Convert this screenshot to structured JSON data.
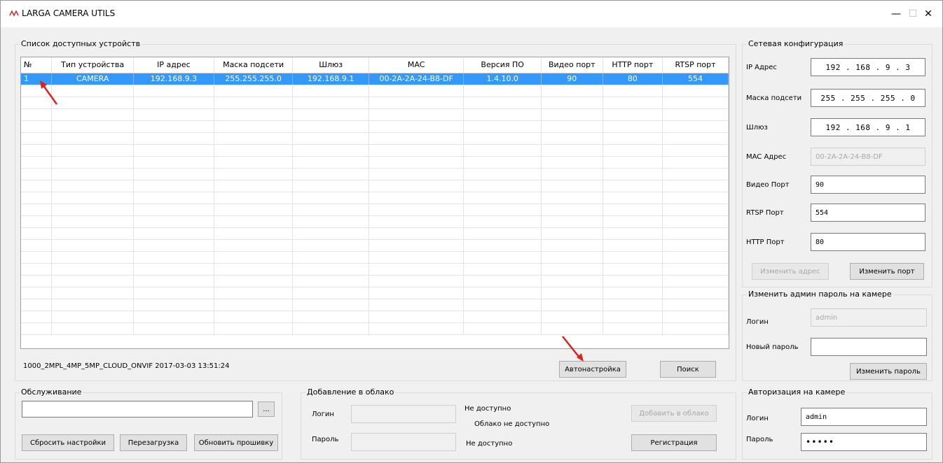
{
  "window": {
    "title": "LARGA CAMERA UTILS",
    "minimize": "—",
    "maximize": "☐",
    "close": "✕"
  },
  "devices": {
    "group_label": "Список доступных устройств",
    "columns": [
      "№",
      "Тип устройства",
      "IP адрес",
      "Маска подсети",
      "Шлюз",
      "MAC",
      "Версия ПО",
      "Видео порт",
      "HTTP порт",
      "RTSP порт"
    ],
    "rows": [
      [
        "1",
        "CAMERA",
        "192.168.9.3",
        "255.255.255.0",
        "192.168.9.1",
        "00-2A-2A-24-B8-DF",
        "1.4.10.0",
        "90",
        "80",
        "554"
      ]
    ],
    "empty_rows": 21,
    "firmware_info": "1000_2MPL_4MP_5MP_CLOUD_ONVIF 2017-03-03 13:51:24",
    "autoconfig_button": "Автонастройка",
    "search_button": "Поиск"
  },
  "network": {
    "group_label": "Сетевая конфигурация",
    "ip_label": "IP Адрес",
    "ip_value": "192 . 168 . 9 . 3",
    "mask_label": "Маска подсети",
    "mask_value": "255 . 255 . 255 . 0",
    "gateway_label": "Шлюз",
    "gateway_value": "192 . 168 . 9 . 1",
    "mac_label": "MAC Адрес",
    "mac_value": "00-2A-2A-24-B8-DF",
    "video_port_label": "Видео Порт",
    "video_port_value": "90",
    "rtsp_port_label": "RTSP Порт",
    "rtsp_port_value": "554",
    "http_port_label": "HTTP Порт",
    "http_port_value": "80",
    "change_address_button": "Изменить адрес",
    "change_port_button": "Изменить порт"
  },
  "admin_password": {
    "group_label": "Изменить админ пароль на камере",
    "login_label": "Логин",
    "login_value": "admin",
    "new_password_label": "Новый пароль",
    "new_password_value": "",
    "change_password_button": "Изменить пароль"
  },
  "maintenance": {
    "group_label": "Обслуживание",
    "file_value": "",
    "browse_button": "...",
    "reset_button": "Сбросить настройки",
    "reboot_button": "Перезагрузка",
    "update_firmware_button": "Обновить прошивку"
  },
  "cloud": {
    "group_label": "Добавление в облако",
    "login_label": "Логин",
    "password_label": "Пароль",
    "status1": "Не доступно",
    "status2": "Облако не доступно",
    "status3": "Не доступно",
    "add_to_cloud_button": "Добавить в облако",
    "register_button": "Регистрация"
  },
  "auth": {
    "group_label": "Авторизация на камере",
    "login_label": "Логин",
    "login_value": "admin",
    "password_label": "Пароль",
    "password_value": "•••••"
  },
  "colors": {
    "selection": "#3399ff",
    "arrow": "#e02020"
  }
}
